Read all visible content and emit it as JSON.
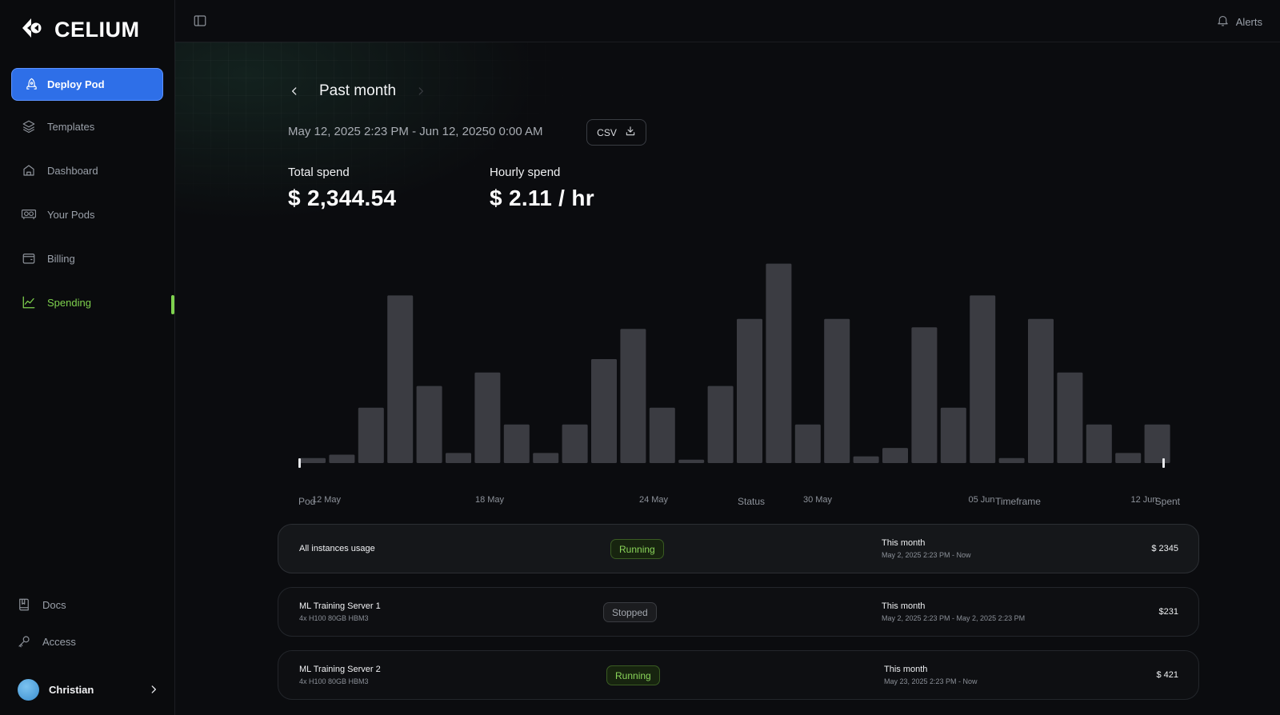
{
  "brand": {
    "name": "CELIUM"
  },
  "sidebar": {
    "deploy_label": "Deploy Pod",
    "items": [
      {
        "label": "Templates",
        "icon": "layers-icon"
      },
      {
        "label": "Dashboard",
        "icon": "home-icon"
      },
      {
        "label": "Your Pods",
        "icon": "gpu-icon"
      },
      {
        "label": "Billing",
        "icon": "wallet-icon"
      },
      {
        "label": "Spending",
        "icon": "line-chart-icon",
        "active": true
      }
    ],
    "bottom": [
      {
        "label": "Docs",
        "icon": "book-icon"
      },
      {
        "label": "Access",
        "icon": "key-icon"
      }
    ],
    "user": {
      "name": "Christian"
    }
  },
  "topbar": {
    "alerts_label": "Alerts"
  },
  "header": {
    "period": "Past month",
    "date_range": "May 12, 2025 2:23 PM -  Jun 12, 20250 0:00 AM",
    "csv_label": "CSV"
  },
  "stats": {
    "total_label": "Total spend",
    "total_value": "$ 2,344.54",
    "hourly_label": "Hourly spend",
    "hourly_value": "$ 2.11 / hr"
  },
  "chart_data": {
    "type": "bar",
    "x_tick_labels": [
      "12 May",
      "18 May",
      "24 May",
      "30 May",
      "05 Jun",
      "12 Jun"
    ],
    "values": [
      3,
      5,
      33,
      100,
      46,
      6,
      54,
      23,
      6,
      23,
      62,
      80,
      33,
      2,
      46,
      86,
      119,
      23,
      86,
      4,
      9,
      81,
      33,
      100,
      3,
      86,
      54,
      23,
      6,
      23
    ],
    "ylim": [
      0,
      125
    ],
    "bar_color": "#3b3c42",
    "note_units": "relative bar heights"
  },
  "table": {
    "headers": {
      "pod": "Pod",
      "status": "Status",
      "timeframe": "Timeframe",
      "spent": "Spent"
    },
    "rows": [
      {
        "name": "All instances usage",
        "sub": "",
        "status": "Running",
        "tf_main": "This month",
        "tf_sub": "May 2, 2025 2:23 PM - Now",
        "spent": "$ 2345"
      },
      {
        "name": "ML Training Server 1",
        "sub": "4x H100 80GB HBM3",
        "status": "Stopped",
        "tf_main": "This month",
        "tf_sub": "May 2, 2025 2:23 PM - May 2, 2025 2:23 PM",
        "spent": "$231"
      },
      {
        "name": "ML Training Server 2",
        "sub": "4x H100 80GB HBM3",
        "status": "Running",
        "tf_main": "This month",
        "tf_sub": "May 23, 2025 2:23 PM - Now",
        "spent": "$ 421"
      }
    ]
  },
  "colors": {
    "accent_green": "#7fd24e",
    "primary_blue": "#2e6fe8",
    "bar": "#3b3c42"
  }
}
